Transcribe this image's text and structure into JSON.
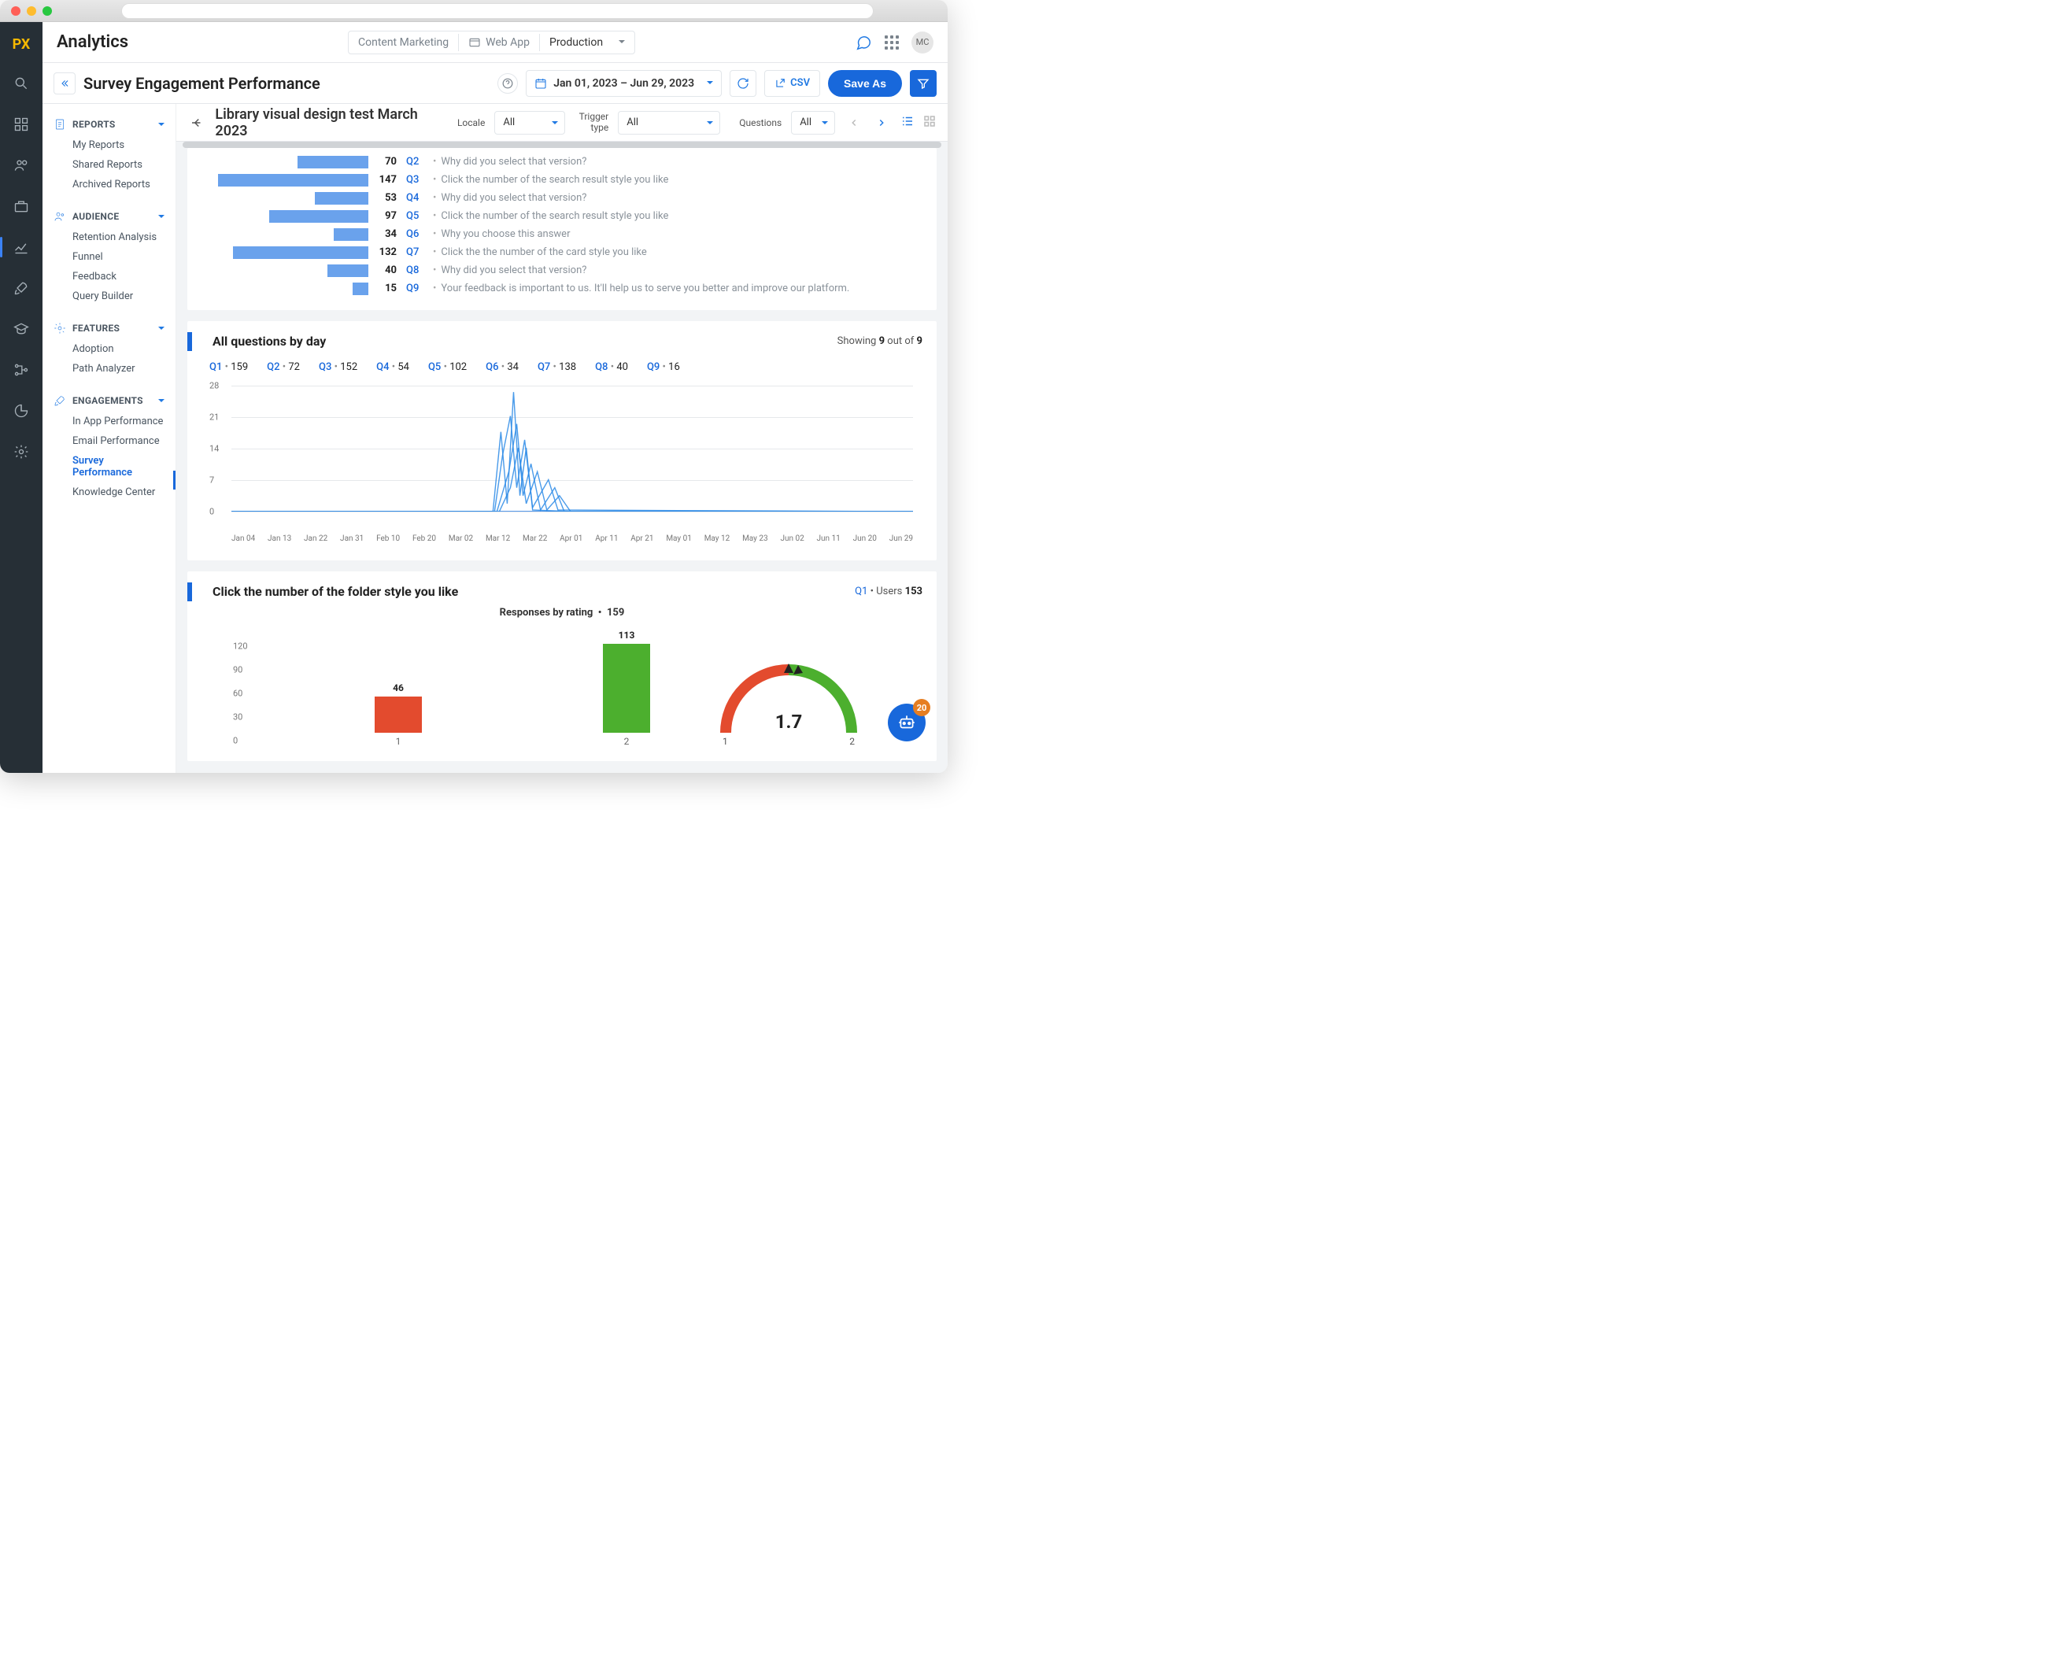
{
  "chrome": {
    "url": ""
  },
  "header": {
    "brand": "Analytics",
    "context": {
      "content_marketing": "Content Marketing",
      "web_app": "Web App",
      "environment": "Production"
    },
    "avatar": "MC"
  },
  "subheader": {
    "title": "Survey Engagement Performance",
    "date_range": "Jan 01, 2023 – Jun 29, 2023",
    "csv": "CSV",
    "save_as": "Save As"
  },
  "sidebar": {
    "reports": {
      "label": "REPORTS",
      "items": [
        "My Reports",
        "Shared Reports",
        "Archived Reports"
      ]
    },
    "audience": {
      "label": "AUDIENCE",
      "items": [
        "Retention Analysis",
        "Funnel",
        "Feedback",
        "Query Builder"
      ]
    },
    "features": {
      "label": "FEATURES",
      "items": [
        "Adoption",
        "Path Analyzer"
      ]
    },
    "engagements": {
      "label": "ENGAGEMENTS",
      "items": [
        "In App Performance",
        "Email Performance",
        "Survey Performance",
        "Knowledge Center"
      ],
      "active_index": 2
    }
  },
  "content_toolbar": {
    "survey_title": "Library visual design test March 2023",
    "locale_label": "Locale",
    "locale_value": "All",
    "trigger_label": "Trigger type",
    "trigger_value": "All",
    "questions_label": "Questions",
    "questions_value": "All"
  },
  "chart_data": [
    {
      "type": "bar",
      "orientation": "horizontal",
      "title": "Questions overview (partial scroll)",
      "categories": [
        "Q2",
        "Q3",
        "Q4",
        "Q5",
        "Q6",
        "Q7",
        "Q8",
        "Q9"
      ],
      "values": [
        70,
        147,
        53,
        97,
        34,
        132,
        40,
        15
      ],
      "bar_widths": [
        90,
        191,
        68,
        126,
        44,
        172,
        52,
        20
      ],
      "questions": [
        "Why did you select that version?",
        "Click the number of the search result style you like",
        "Why did you select that version?",
        "Click the number of the search result style you like",
        "Why you choose this answer",
        "Click the the number of the card style you like",
        "Why did you select that version?",
        "Your feedback is important to us. It'll help us to serve you better and improve our platform."
      ]
    },
    {
      "type": "line",
      "title": "All questions by day",
      "showing_text_prefix": "Showing",
      "showing_count": "9",
      "showing_text_mid": "out of",
      "showing_total": "9",
      "legend": [
        {
          "tag": "Q1",
          "count": "159"
        },
        {
          "tag": "Q2",
          "count": "72"
        },
        {
          "tag": "Q3",
          "count": "152"
        },
        {
          "tag": "Q4",
          "count": "54"
        },
        {
          "tag": "Q5",
          "count": "102"
        },
        {
          "tag": "Q6",
          "count": "34"
        },
        {
          "tag": "Q7",
          "count": "138"
        },
        {
          "tag": "Q8",
          "count": "40"
        },
        {
          "tag": "Q9",
          "count": "16"
        }
      ],
      "y_ticks": [
        0,
        7,
        14,
        21,
        28
      ],
      "x_labels": [
        "Jan 04",
        "Jan 13",
        "Jan 22",
        "Jan 31",
        "Feb 10",
        "Feb 20",
        "Mar 02",
        "Mar 12",
        "Mar 22",
        "Apr 01",
        "Apr 11",
        "Apr 21",
        "May 01",
        "May 12",
        "May 23",
        "Jun 02",
        "Jun 11",
        "Jun 20",
        "Jun 29"
      ],
      "xlim": [
        "2023-01-04",
        "2023-06-29"
      ],
      "ylim": [
        0,
        28
      ],
      "note": "All 9 series near-zero except spike cluster roughly Mar 08 – Apr 01 peaking ~28"
    },
    {
      "type": "bar",
      "title": "Click the number of the folder style you like",
      "meta_tag": "Q1",
      "meta_users_label": "Users",
      "meta_users": "153",
      "subtitle": "Responses by rating",
      "subtitle_count": "159",
      "categories": [
        "1",
        "2"
      ],
      "values": [
        46,
        113
      ],
      "colors": [
        "#e34b2e",
        "#4caf2e"
      ],
      "y_ticks": [
        0,
        30,
        60,
        90,
        120
      ],
      "ylim": [
        0,
        130
      ]
    },
    {
      "type": "gauge",
      "value": 1.7,
      "range": [
        1,
        2
      ],
      "colors": [
        "#e34b2e",
        "#4caf2e"
      ],
      "pointer": 1.7
    }
  ],
  "chatbot": {
    "badge": "20"
  }
}
